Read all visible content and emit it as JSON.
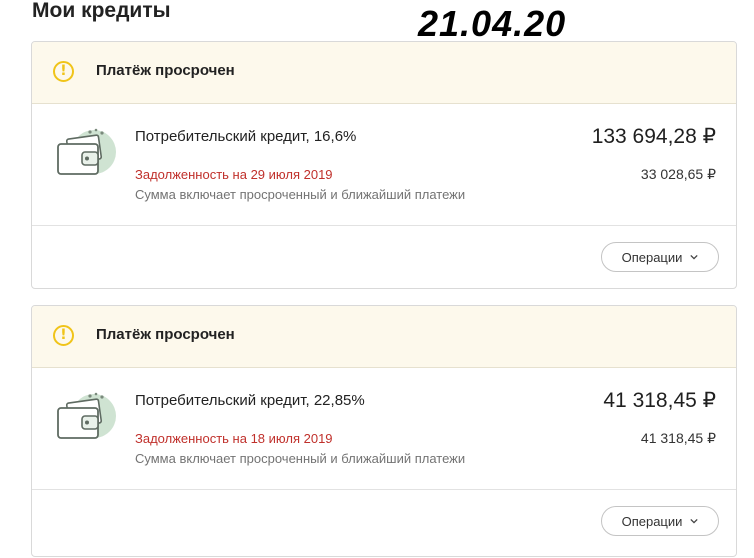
{
  "page": {
    "title": "Мои кредиты",
    "date_stamp": "21.04.20"
  },
  "icons": {
    "warning": "warning-circle-icon",
    "wallet": "wallet-icon",
    "chevron": "chevron-down-icon"
  },
  "colors": {
    "warning_bg": "#fdf9ec",
    "warning_accent": "#f0c419",
    "debt_red": "#c0302b",
    "icon_green": "#cfe3d2"
  },
  "loans": [
    {
      "status": "Платёж просрочен",
      "name": "Потребительский кредит, 16,6%",
      "total_amount": "133 694,28 ₽",
      "debt_label": "Задолженность на 29 июля 2019",
      "debt_amount": "33 028,65 ₽",
      "note": "Сумма включает просроченный и ближайший платежи",
      "operations_label": "Операции"
    },
    {
      "status": "Платёж просрочен",
      "name": "Потребительский кредит, 22,85%",
      "total_amount": "41 318,45 ₽",
      "debt_label": "Задолженность на 18 июля 2019",
      "debt_amount": "41 318,45 ₽",
      "note": "Сумма включает просроченный и ближайший платежи",
      "operations_label": "Операции"
    }
  ]
}
